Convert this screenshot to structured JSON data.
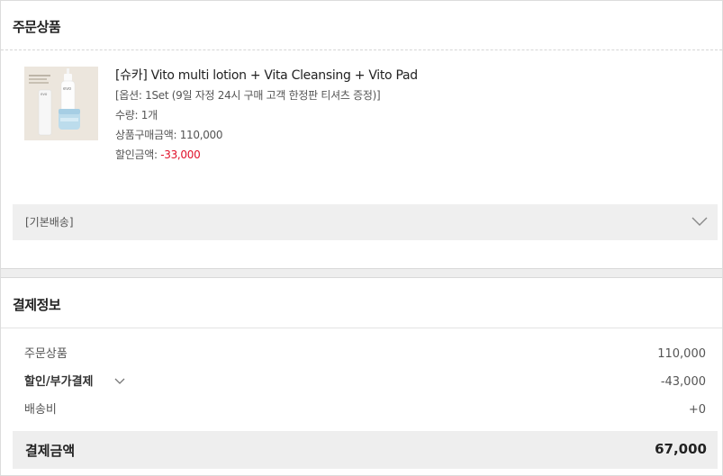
{
  "order_section": {
    "title": "주문상품",
    "product": {
      "name": "[슈카] Vito multi lotion + Vita Cleansing + Vito Pad",
      "option": "[옵션: 1Set (9일 자정 24시 구매 고객 한정판 티셔츠 증정)]",
      "quantity_label": "수량: ",
      "quantity_value": "1개",
      "purchase_price_label": "상품구매금액: ",
      "purchase_price_value": "110,000",
      "discount_label": "할인금액: ",
      "discount_value": "-33,000",
      "image_icon": "product-photo",
      "brand_text_on_image": "evo"
    },
    "shipping": {
      "label": "[기본배송]",
      "toggle_icon": "chevron-down-icon"
    }
  },
  "payment_section": {
    "title": "결제정보",
    "rows": [
      {
        "label": "주문상품",
        "value": "110,000"
      },
      {
        "label": "할인/부가결제",
        "value": "-43,000"
      },
      {
        "label": "배송비",
        "value": "+0"
      }
    ],
    "total": {
      "label": "결제금액",
      "value": "67,000"
    }
  },
  "colors": {
    "discount": "#e0112a",
    "bar_bg": "#efefef",
    "text": "#222222",
    "muted": "#555555"
  }
}
